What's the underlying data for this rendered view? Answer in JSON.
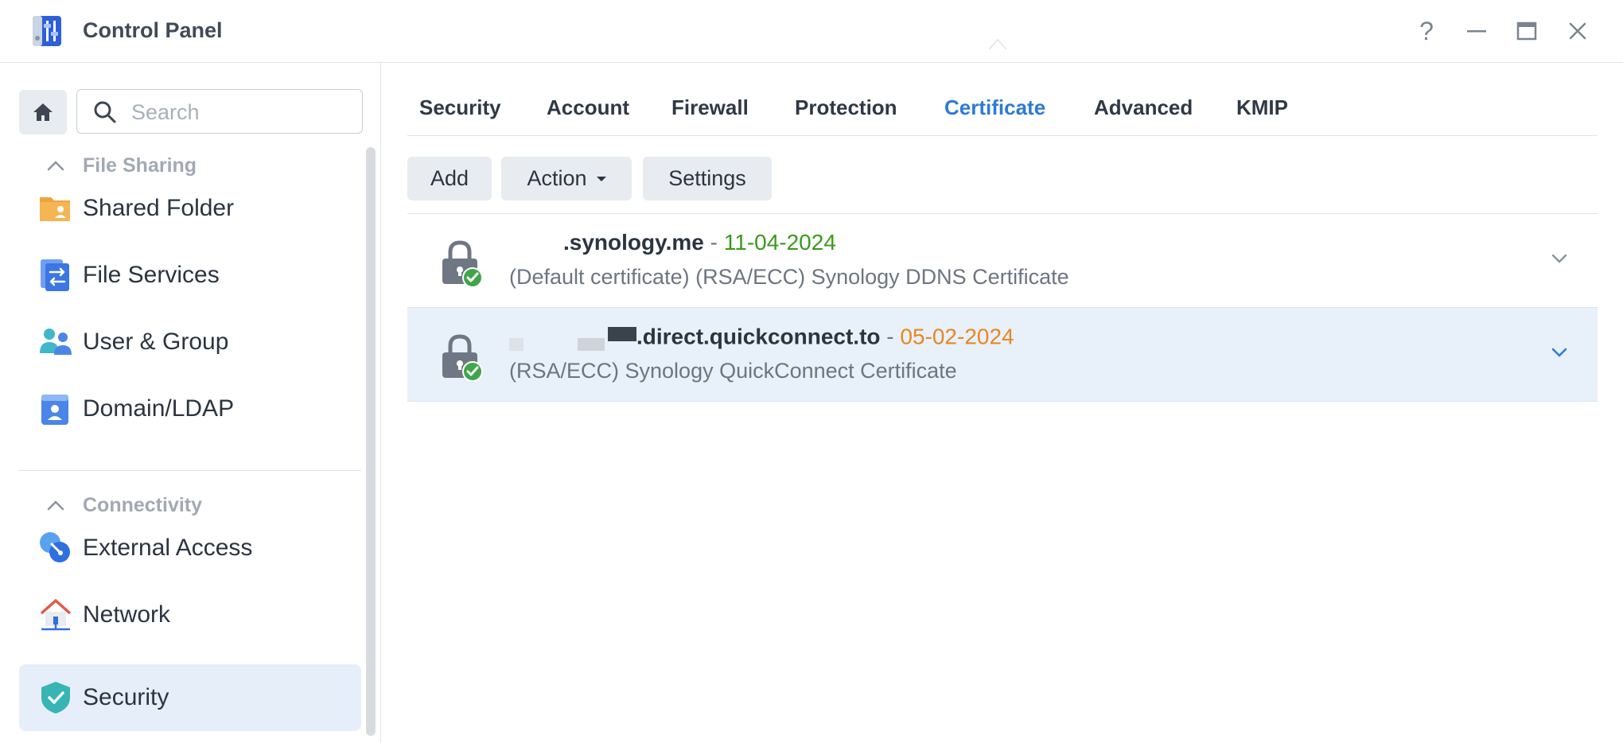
{
  "window": {
    "title": "Control Panel",
    "controls": {
      "help": "?"
    }
  },
  "sidebar": {
    "search_placeholder": "Search",
    "groups": [
      {
        "label": "File Sharing",
        "items": [
          {
            "label": "Shared Folder",
            "icon": "shared-folder-icon"
          },
          {
            "label": "File Services",
            "icon": "file-services-icon"
          },
          {
            "label": "User & Group",
            "icon": "user-group-icon"
          },
          {
            "label": "Domain/LDAP",
            "icon": "domain-ldap-icon"
          }
        ]
      },
      {
        "label": "Connectivity",
        "items": [
          {
            "label": "External Access",
            "icon": "external-access-icon"
          },
          {
            "label": "Network",
            "icon": "network-icon"
          },
          {
            "label": "Security",
            "icon": "security-shield-icon",
            "active": true
          }
        ]
      }
    ]
  },
  "tabs": [
    {
      "label": "Security"
    },
    {
      "label": "Account"
    },
    {
      "label": "Firewall"
    },
    {
      "label": "Protection"
    },
    {
      "label": "Certificate",
      "active": true
    },
    {
      "label": "Advanced"
    },
    {
      "label": "KMIP"
    }
  ],
  "toolbar": {
    "add": "Add",
    "action": "Action",
    "settings": "Settings"
  },
  "certificates": [
    {
      "domain": ".synology.me",
      "separator": "-",
      "expiry": "11-04-2024",
      "expiry_color": "#3a9a1d",
      "description": "(Default certificate) (RSA/ECC) Synology DDNS Certificate",
      "selected": false
    },
    {
      "domain": ".direct.quickconnect.to",
      "separator": "-",
      "expiry": "05-02-2024",
      "expiry_color": "#e8871e",
      "description": "(RSA/ECC) Synology QuickConnect Certificate",
      "selected": true
    }
  ],
  "colors": {
    "accent": "#2e7ad6",
    "selected_row": "#e8f0fa",
    "active_nav": "#e6eff9"
  }
}
